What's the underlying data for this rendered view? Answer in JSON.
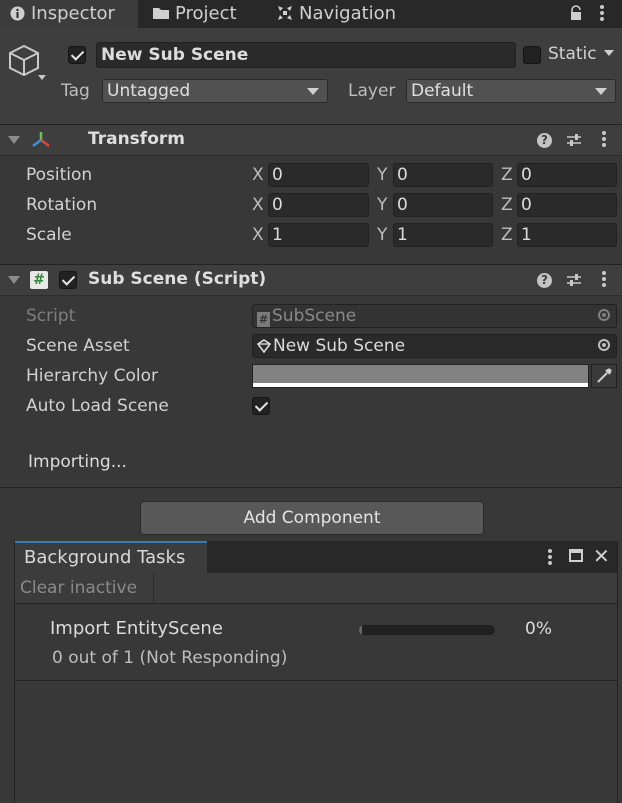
{
  "tabs": [
    {
      "label": "Inspector",
      "icon": "info-icon"
    },
    {
      "label": "Project",
      "icon": "folder-icon"
    },
    {
      "label": "Navigation",
      "icon": "navigation-icon"
    }
  ],
  "object": {
    "name": "New Sub Scene",
    "active": true,
    "static_label": "Static",
    "static": false,
    "tag_label": "Tag",
    "tag_value": "Untagged",
    "layer_label": "Layer",
    "layer_value": "Default"
  },
  "transform": {
    "title": "Transform",
    "rows": [
      {
        "label": "Position",
        "x": "0",
        "y": "0",
        "z": "0"
      },
      {
        "label": "Rotation",
        "x": "0",
        "y": "0",
        "z": "0"
      },
      {
        "label": "Scale",
        "x": "1",
        "y": "1",
        "z": "1"
      }
    ],
    "axes": [
      "X",
      "Y",
      "Z"
    ]
  },
  "subscene": {
    "title": "Sub Scene (Script)",
    "enabled": true,
    "script_label": "Script",
    "script_value": "SubScene",
    "scene_asset_label": "Scene Asset",
    "scene_asset_value": "New Sub Scene",
    "hierarchy_color_label": "Hierarchy Color",
    "hierarchy_color": "#828282",
    "auto_load_label": "Auto Load Scene",
    "auto_load": true,
    "status": "Importing..."
  },
  "add_component_label": "Add Component",
  "background_tasks": {
    "tab_label": "Background Tasks",
    "clear_inactive_label": "Clear inactive",
    "task_name": "Import EntityScene",
    "task_status": "0 out of 1 (Not Responding)",
    "progress_label": "0%",
    "progress": 0.02
  },
  "colors": {
    "accent": "#3a79bb",
    "panel": "#383838",
    "header": "#3e3e3e"
  }
}
